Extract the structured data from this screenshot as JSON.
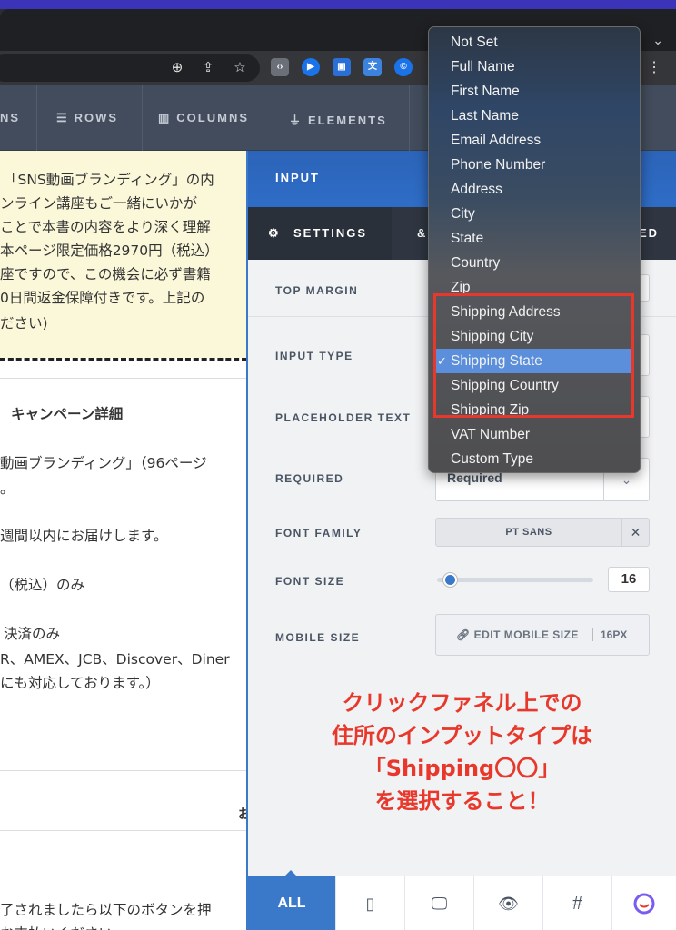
{
  "editor_nav": {
    "items": [
      {
        "icon": "rows-icon",
        "label": "ROWS"
      },
      {
        "icon": "columns-icon",
        "label": "COLUMNS"
      },
      {
        "icon": "elements-icon",
        "label": "ELEMENTS"
      }
    ],
    "partial_left": "NS"
  },
  "page_content": {
    "paragraph_lines": [
      "「SNS動画ブランディング」の内",
      "ンライン講座もご一緒にいかが",
      "ことで本書の内容をより深く理解",
      "本ページ限定価格2970円（税込）",
      "座ですので、この機会に必ず書籍",
      "0日間返金保障付きです。上記の",
      "ださい)"
    ],
    "heading": "キャンペーン詳細",
    "detail_lines": [
      "動画ブランディング」（96ページ",
      "。",
      "週間以内にお届けします。",
      "（税込）のみ",
      "決済のみ",
      "R、AMEX、JCB、Discover、Diner",
      "にも対応しております。）"
    ],
    "footer_fragment": "お",
    "bottom_lines": [
      "了されましたら以下のボタンを押",
      "お支払いください"
    ]
  },
  "panel": {
    "title": "INPUT",
    "tabs": {
      "settings": "SETTINGS",
      "other_partial": "&",
      "advanced_partial": "ED"
    },
    "rows": {
      "top_margin": "TOP MARGIN",
      "input_type": "INPUT TYPE",
      "placeholder_text": "PLACEHOLDER TEXT",
      "required": "REQUIRED",
      "required_value": "Required",
      "font_family": "FONT FAMILY",
      "font_family_value": "PT SANS",
      "font_size": "FONT SIZE",
      "font_size_value": "16",
      "font_size_slider": 0.05,
      "mobile_size": "MOBILE SIZE",
      "edit_mobile_label": "EDIT MOBILE SIZE",
      "edit_mobile_value": "16PX"
    },
    "annotation_lines": [
      "クリックファネル上での",
      "住所のインプットタイプは",
      "「Shipping〇〇」",
      "を選択すること！"
    ],
    "bottom_bar": {
      "all_label": "ALL",
      "icons": [
        "mobile-icon",
        "desktop-icon",
        "eye-icon",
        "hash-icon",
        "chat-bubble-icon"
      ],
      "hash_glyph": "#"
    }
  },
  "dropdown": {
    "options": [
      "Not Set",
      "Full Name",
      "First Name",
      "Last Name",
      "Email Address",
      "Phone Number",
      "Address",
      "City",
      "State",
      "Country",
      "Zip",
      "Shipping Address",
      "Shipping City",
      "Shipping State",
      "Shipping Country",
      "Shipping Zip",
      "VAT Number",
      "Custom Type"
    ],
    "selected": "Shipping State",
    "check_glyph": "✓"
  },
  "colors": {
    "accent_blue": "#3a78c9",
    "annotation_red": "#e8382b",
    "nav_bg": "#424c5c"
  }
}
